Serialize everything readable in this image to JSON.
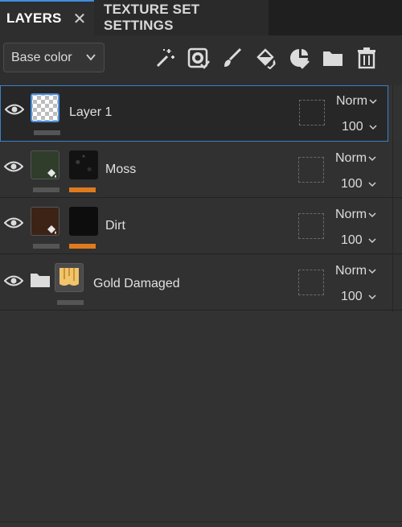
{
  "tabs": {
    "layers_label": "LAYERS",
    "texture_set_label": "TEXTURE SET SETTINGS"
  },
  "toolbar": {
    "channel_value": "Base color",
    "icons": [
      "magic-wand-icon",
      "smart-mask-icon",
      "paint-brush-icon",
      "fill-bucket-icon",
      "smart-material-icon",
      "folder-icon",
      "trash-icon"
    ]
  },
  "layers": [
    {
      "name": "Layer 1",
      "blend_mode": "Norm",
      "opacity": "100",
      "selected": true,
      "type": "paint"
    },
    {
      "name": "Moss",
      "blend_mode": "Norm",
      "opacity": "100",
      "selected": false,
      "type": "fill",
      "color": "#2f3d2a"
    },
    {
      "name": "Dirt",
      "blend_mode": "Norm",
      "opacity": "100",
      "selected": false,
      "type": "fill",
      "color": "#3d2216"
    },
    {
      "name": "Gold Damaged",
      "blend_mode": "Norm",
      "opacity": "100",
      "selected": false,
      "type": "folder"
    }
  ],
  "colors": {
    "accent_blue": "#3c8fe0",
    "mask_orange": "#e07a1f",
    "panel_bg": "#323232"
  }
}
